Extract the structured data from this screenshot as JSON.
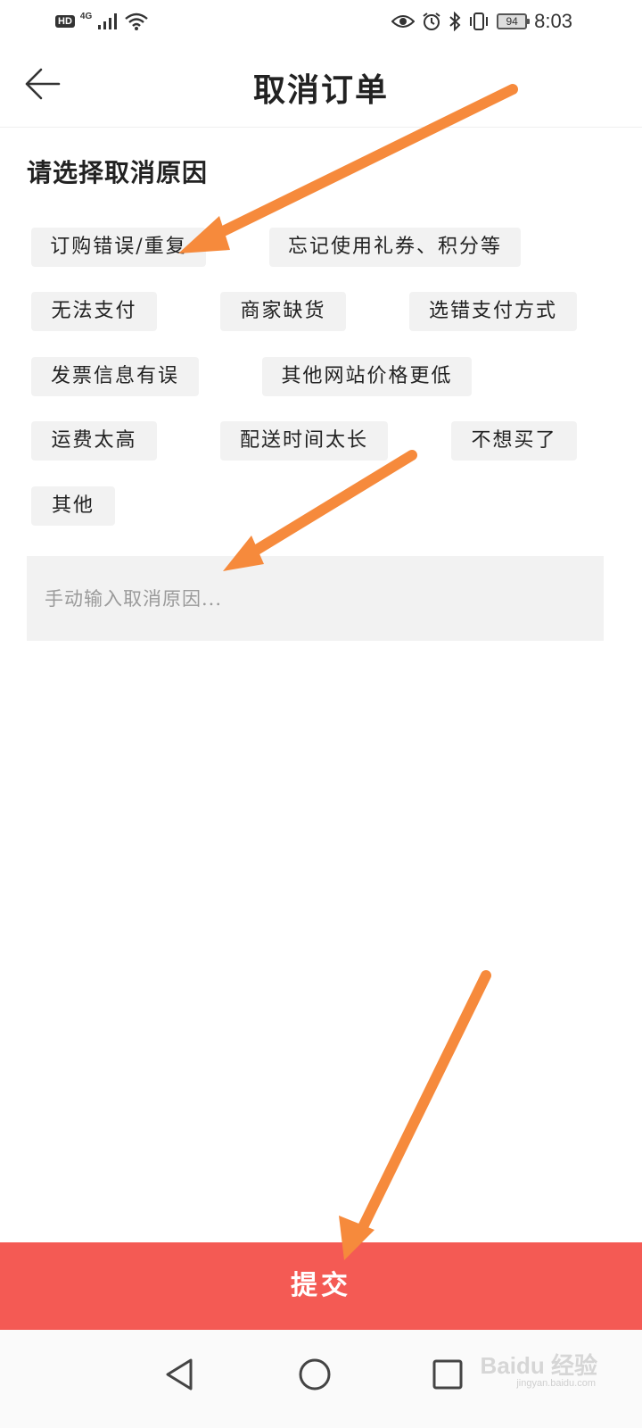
{
  "status_bar": {
    "hd_badge": "HD",
    "network": "4G",
    "battery": "94",
    "time": "8:03"
  },
  "header": {
    "title": "取消订单"
  },
  "section": {
    "title": "请选择取消原因"
  },
  "reasons": [
    "订购错误/重复",
    "忘记使用礼券、积分等",
    "无法支付",
    "商家缺货",
    "选错支付方式",
    "发票信息有误",
    "其他网站价格更低",
    "运费太高",
    "配送时间太长",
    "不想买了",
    "其他"
  ],
  "manual_input": {
    "placeholder": "手动输入取消原因..."
  },
  "submit": {
    "label": "提交"
  },
  "watermark": {
    "brand": "Baidu 经验",
    "domain": "jingyan.baidu.com"
  },
  "colors": {
    "submit_bg": "#f45a54",
    "chip_bg": "#f2f2f2",
    "annotation_arrow": "#f68a3c"
  },
  "icons": {
    "back": "back-arrow-icon",
    "eye": "eye-icon",
    "alarm": "alarm-icon",
    "bluetooth": "bluetooth-icon",
    "vibrate": "vibrate-icon",
    "signal": "signal-icon",
    "wifi": "wifi-icon"
  }
}
